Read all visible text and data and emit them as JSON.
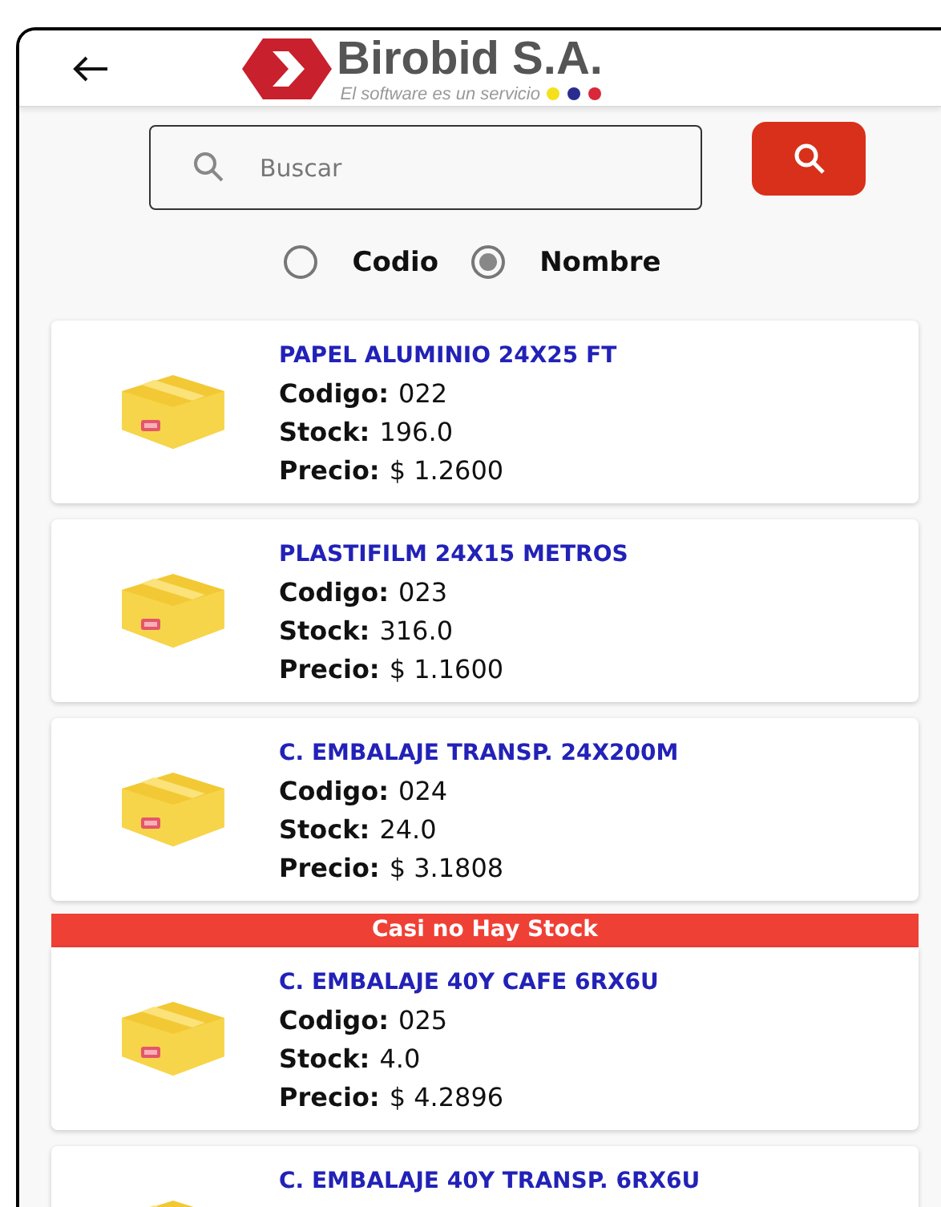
{
  "header": {
    "brand": "Birobid S.A.",
    "tagline": "El software es un servicio"
  },
  "search": {
    "placeholder": "Buscar"
  },
  "search_by": [
    {
      "label": "Codio",
      "selected": false
    },
    {
      "label": "Nombre",
      "selected": true
    }
  ],
  "products": [
    {
      "name": "PAPEL ALUMINIO 24X25 FT",
      "fields": [
        {
          "label": "Codigo:",
          "value": "022"
        },
        {
          "label": "Stock:",
          "value": "196.0"
        },
        {
          "label": "Precio:",
          "value": "$ 1.2600"
        }
      ]
    },
    {
      "name": "PLASTIFILM 24X15 METROS",
      "fields": [
        {
          "label": "Codigo:",
          "value": "023"
        },
        {
          "label": "Stock:",
          "value": "316.0"
        },
        {
          "label": "Precio:",
          "value": "$ 1.1600"
        }
      ]
    },
    {
      "name": "C. EMBALAJE TRANSP. 24X200M",
      "fields": [
        {
          "label": "Codigo:",
          "value": "024"
        },
        {
          "label": "Stock:",
          "value": "24.0"
        },
        {
          "label": "Precio:",
          "value": "$ 3.1808"
        }
      ]
    },
    {
      "name": "C. EMBALAJE 40Y CAFE 6RX6U",
      "alert": "Casi no Hay Stock",
      "fields": [
        {
          "label": "Codigo:",
          "value": "025"
        },
        {
          "label": "Stock:",
          "value": "4.0"
        },
        {
          "label": "Precio:",
          "value": "$ 4.2896"
        }
      ]
    },
    {
      "name": "C. EMBALAJE 40Y TRANSP. 6RX6U"
    }
  ]
}
